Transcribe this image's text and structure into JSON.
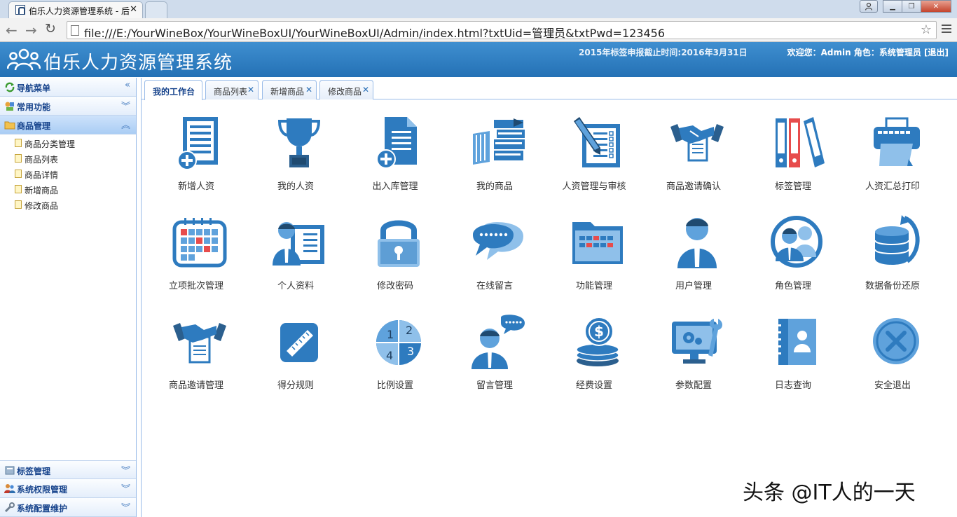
{
  "browser": {
    "tab_title": "伯乐人力资源管理系统 - 后",
    "url": "file:///E:/YourWineBox/YourWineBoxUI/YourWineBoxUI/Admin/index.html?txtUid=管理员&txtPwd=123456"
  },
  "header": {
    "title": "伯乐人力资源管理系统",
    "deadline": "2015年标签申报截止时间:2016年3月31日",
    "user_info": "欢迎您：Admin 角色：系统管理员 [退出]"
  },
  "sidebar": {
    "top_sections": [
      {
        "label": "导航菜单",
        "chevron": "«"
      },
      {
        "label": "常用功能",
        "chevron": "︾"
      },
      {
        "label": "商品管理",
        "chevron": "︽"
      }
    ],
    "items": [
      "商品分类管理",
      "商品列表",
      "商品详情",
      "新增商品",
      "修改商品"
    ],
    "bottom_sections": [
      {
        "label": "标签管理",
        "chevron": "︾"
      },
      {
        "label": "系统权限管理",
        "chevron": "︾"
      },
      {
        "label": "系统配置维护",
        "chevron": "︾"
      }
    ]
  },
  "content_tabs": [
    {
      "label": "我的工作台",
      "closable": false
    },
    {
      "label": "商品列表",
      "closable": true
    },
    {
      "label": "新增商品",
      "closable": true
    },
    {
      "label": "修改商品",
      "closable": true
    }
  ],
  "tiles": [
    {
      "label": "新增人资",
      "icon": "document-add-icon"
    },
    {
      "label": "我的人资",
      "icon": "trophy-icon"
    },
    {
      "label": "出入库管理",
      "icon": "file-add-icon"
    },
    {
      "label": "我的商品",
      "icon": "books-icon"
    },
    {
      "label": "人资管理与审核",
      "icon": "checklist-pen-icon"
    },
    {
      "label": "商品邀请确认",
      "icon": "handshake-contract-icon"
    },
    {
      "label": "标签管理",
      "icon": "binders-icon"
    },
    {
      "label": "人资汇总打印",
      "icon": "printer-icon"
    },
    {
      "label": "立项批次管理",
      "icon": "calendar-icon"
    },
    {
      "label": "个人资料",
      "icon": "profile-card-icon"
    },
    {
      "label": "修改密码",
      "icon": "padlock-icon"
    },
    {
      "label": "在线留言",
      "icon": "speech-bubble-icon"
    },
    {
      "label": "功能管理",
      "icon": "folder-grid-icon"
    },
    {
      "label": "用户管理",
      "icon": "user-icon"
    },
    {
      "label": "角色管理",
      "icon": "role-users-icon"
    },
    {
      "label": "数据备份还原",
      "icon": "database-restore-icon"
    },
    {
      "label": "商品邀请管理",
      "icon": "handshake-icon"
    },
    {
      "label": "得分规则",
      "icon": "ruler-icon"
    },
    {
      "label": "比例设置",
      "icon": "pie-quarters-icon"
    },
    {
      "label": "留言管理",
      "icon": "user-message-icon"
    },
    {
      "label": "经费设置",
      "icon": "coins-icon"
    },
    {
      "label": "参数配置",
      "icon": "monitor-wrench-icon"
    },
    {
      "label": "日志查询",
      "icon": "address-book-icon"
    },
    {
      "label": "安全退出",
      "icon": "exit-circle-icon"
    }
  ],
  "pie_numbers": [
    "1",
    "2",
    "3",
    "4"
  ],
  "watermark": "头条 @IT人的一天",
  "colors": {
    "accent_blue": "#2e7bbf",
    "header_blue": "#2a78ba",
    "red": "#e74c4c"
  }
}
